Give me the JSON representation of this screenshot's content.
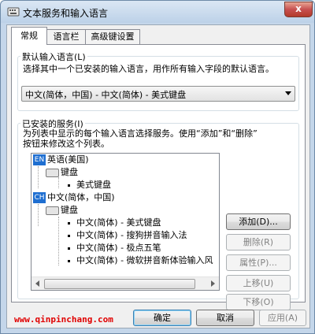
{
  "window": {
    "title": "文本服务和输入语言",
    "close_glyph": "x"
  },
  "tabs": [
    {
      "label": "常规",
      "active": true
    },
    {
      "label": "语言栏",
      "active": false
    },
    {
      "label": "高级键设置",
      "active": false
    }
  ],
  "default_language": {
    "group_title": "默认输入语言(L)",
    "description": "选择其中一个已安装的输入语言，用作所有输入字段的默认语言。",
    "selected": "中文(简体，中国) - 中文(简体) - 美式键盘"
  },
  "installed_services": {
    "group_title": "已安装的服务(I)",
    "description_line1": "为列表中显示的每个输入语言选择服务。使用“添加”和“删除”",
    "description_line2": "按钮来修改这个列表。",
    "tree": {
      "lang1": {
        "badge": "EN",
        "label": "英语(美国)",
        "category": "键盘",
        "items": [
          "美式键盘"
        ]
      },
      "lang2": {
        "badge": "CH",
        "label": "中文(简体，中国)",
        "category": "键盘",
        "items": [
          "中文(简体) - 美式键盘",
          "中文(简体) - 搜狗拼音输入法",
          "中文(简体) - 极点五笔",
          "中文(简体) - 微软拼音新体验输入风"
        ]
      }
    },
    "buttons": {
      "add": "添加(D)...",
      "remove": "删除(R)",
      "properties": "属性(P)...",
      "move_up": "上移(U)",
      "move_down": "下移(O)"
    }
  },
  "dialog_buttons": {
    "ok": "确定",
    "cancel": "取消",
    "apply": "应用(A)"
  },
  "watermark": "www.qinpinchang.com",
  "colors": {
    "badge": "#1f6fd1",
    "watermark": "#e00000",
    "frame": "#c4d6ea"
  }
}
